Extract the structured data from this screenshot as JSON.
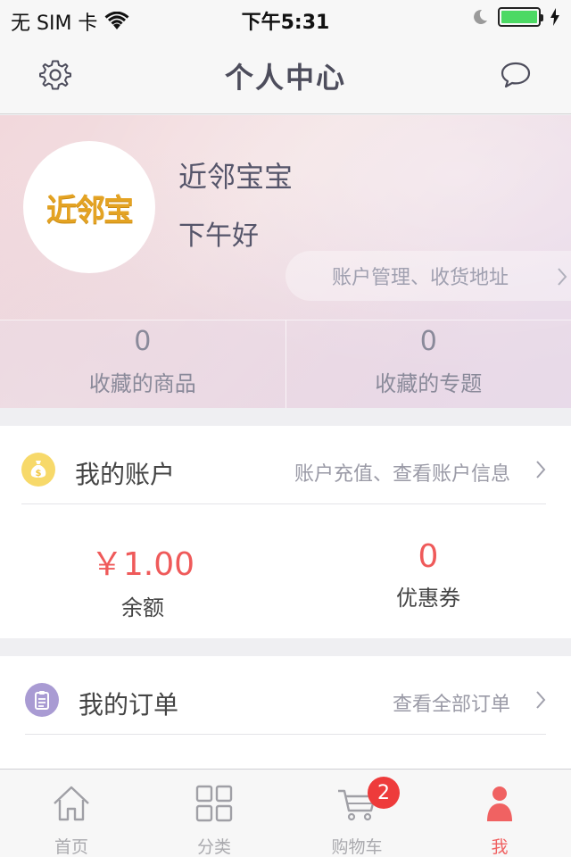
{
  "status_bar": {
    "carrier": "无 SIM 卡",
    "time": "下午5:31"
  },
  "nav": {
    "title": "个人中心"
  },
  "profile": {
    "avatar_logo_text": "近邻宝",
    "username": "近邻宝宝",
    "greeting": "下午好",
    "account_link": "账户管理、收货地址",
    "favorites": [
      {
        "count": "0",
        "label": "收藏的商品"
      },
      {
        "count": "0",
        "label": "收藏的专题"
      }
    ]
  },
  "account": {
    "title": "我的账户",
    "hint": "账户充值、查看账户信息",
    "icon": "money-bag-icon",
    "icon_color": "#f7d96a",
    "balance_value": "￥1.00",
    "balance_label": "余额",
    "coupon_value": "0",
    "coupon_label": "优惠券"
  },
  "orders": {
    "title": "我的订单",
    "hint": "查看全部订单",
    "icon": "clipboard-icon",
    "icon_color": "#a99bd3"
  },
  "tab_bar": {
    "tabs": [
      {
        "label": "首页",
        "icon": "home-icon"
      },
      {
        "label": "分类",
        "icon": "grid-icon"
      },
      {
        "label": "购物车",
        "icon": "cart-icon",
        "badge": "2"
      },
      {
        "label": "我",
        "icon": "person-icon",
        "active": true
      }
    ]
  },
  "colors": {
    "accent": "#ef5a5a",
    "battery": "#4cd964"
  }
}
